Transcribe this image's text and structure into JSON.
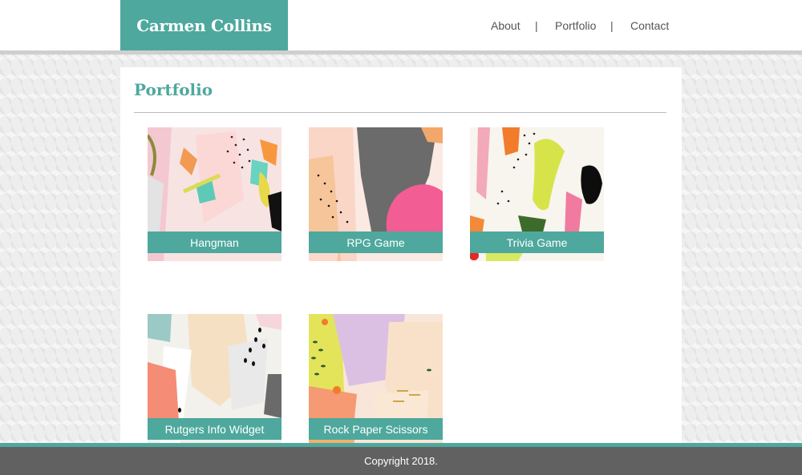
{
  "header": {
    "brand": "Carmen Collins"
  },
  "nav": {
    "items": [
      "About",
      "Portfolio",
      "Contact"
    ],
    "separator": "|"
  },
  "main": {
    "title": "Portfolio"
  },
  "projects": [
    {
      "title": "Hangman"
    },
    {
      "title": "RPG Game"
    },
    {
      "title": "Trivia Game"
    },
    {
      "title": "Rutgers Info Widget"
    },
    {
      "title": "Rock Paper Scissors"
    }
  ],
  "footer": {
    "copyright": "Copyright 2018."
  },
  "colors": {
    "accent": "#4ea89d",
    "footer": "#616161",
    "header_border": "#cfcfcf"
  }
}
